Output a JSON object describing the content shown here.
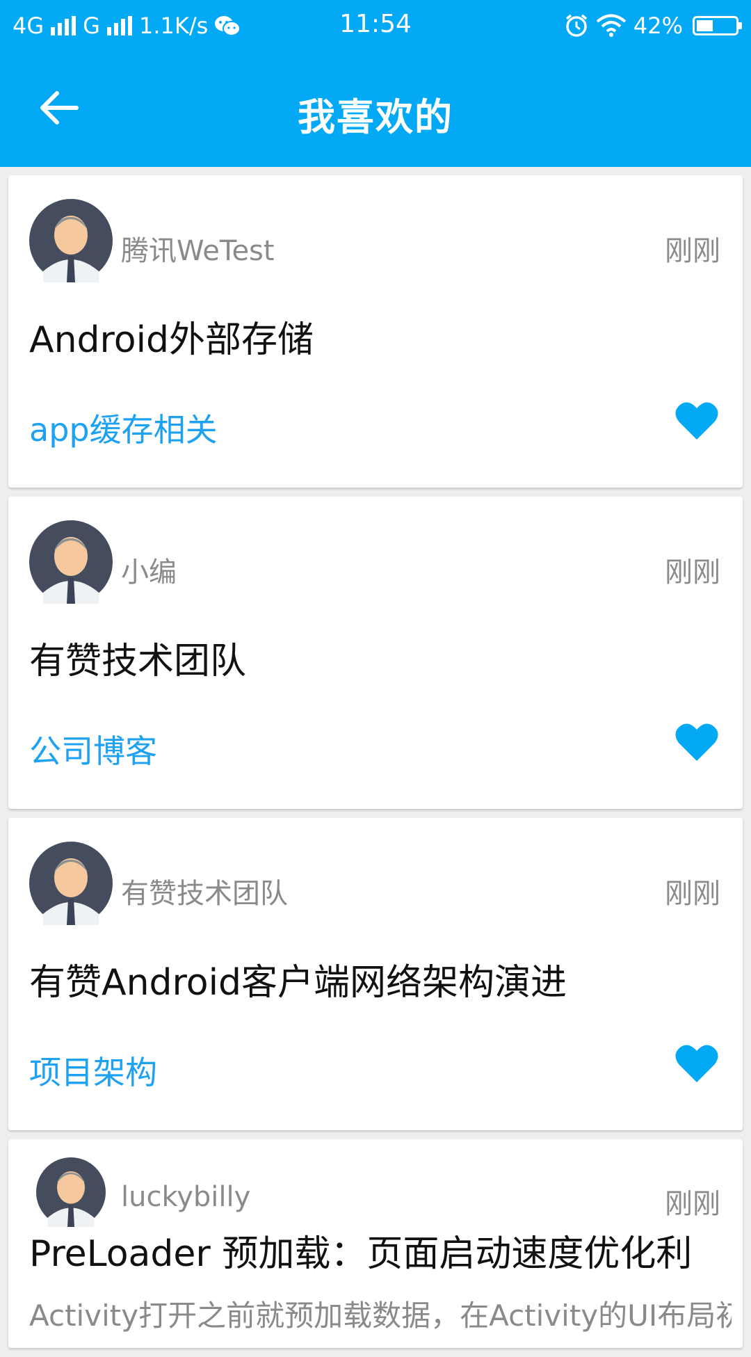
{
  "status_bar": {
    "network1": "4G",
    "network2": "G",
    "speed": "1.1K/s",
    "time": "11:54",
    "battery_percent": "42%",
    "battery_level": 0.42,
    "icons": [
      "signal-icon",
      "wechat-icon",
      "alarm-icon",
      "wifi-icon",
      "battery-icon"
    ]
  },
  "app_bar": {
    "title": "我喜欢的",
    "back_icon": "arrow-left-icon"
  },
  "colors": {
    "primary": "#03a9f4",
    "tag": "#1da1f2",
    "heart": "#03a9f4",
    "muted": "#8a8a8a"
  },
  "cards": [
    {
      "author": "腾讯WeTest",
      "time": "刚刚",
      "title": "Android外部存储",
      "tag": "app缓存相关",
      "liked": true
    },
    {
      "author": "小编",
      "time": "刚刚",
      "title": "有赞技术团队",
      "tag": "公司博客",
      "liked": true
    },
    {
      "author": "有赞技术团队",
      "time": "刚刚",
      "title": "有赞Android客户端网络架构演进",
      "tag": "项目架构",
      "liked": true
    },
    {
      "author": "luckybilly",
      "time": "刚刚",
      "title": "PreLoader 预加载：页面启动速度优化利器",
      "description": "Activity打开之前就预加载数据，在Activity的UI布局初"
    }
  ]
}
